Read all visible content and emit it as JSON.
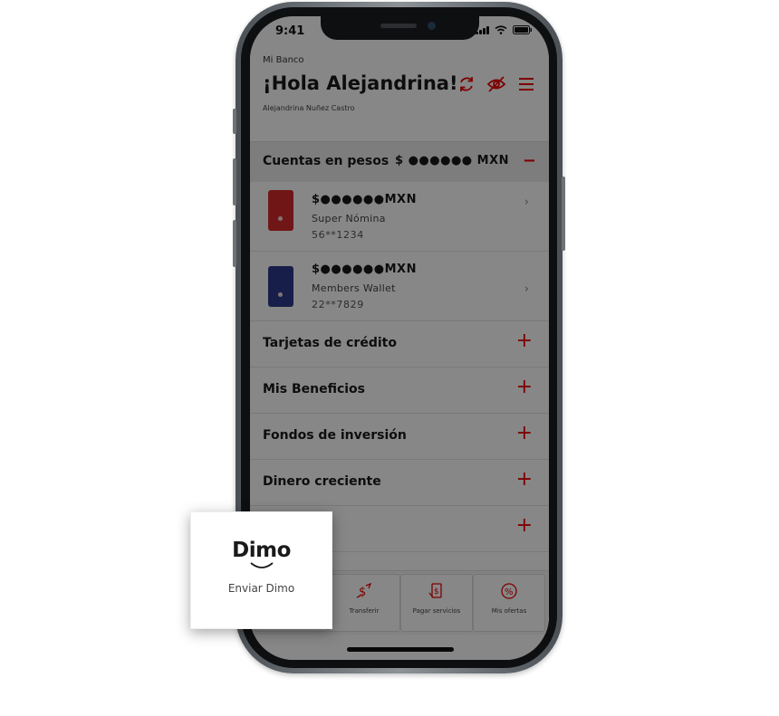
{
  "status_bar": {
    "time": "9:41"
  },
  "header": {
    "bank_label": "Mi Banco",
    "greeting": "¡Hola Alejandrina!",
    "user_name": "Alejandrina Nuñez Castro",
    "icons": [
      "refresh-icon",
      "hide-balance-icon",
      "menu-icon"
    ]
  },
  "accounts_section": {
    "title": "Cuentas en pesos",
    "amount": "$ ●●●●●● MXN",
    "toggle": "−",
    "items": [
      {
        "amount": "$●●●●●●MXN",
        "name": "Super Nómina",
        "number": "56**1234",
        "card_color": "#d62b2b"
      },
      {
        "amount": "$●●●●●●MXN",
        "name": "Members Wallet",
        "number": " 22**7829",
        "card_color": "#2c3a8c"
      }
    ]
  },
  "sections": [
    {
      "label": "Tarjetas de crédito",
      "toggle": "+"
    },
    {
      "label": "Mis Beneficios",
      "toggle": "+"
    },
    {
      "label": "Fondos de inversión",
      "toggle": "+"
    },
    {
      "label": "Dinero creciente",
      "toggle": "+"
    },
    {
      "label": "",
      "toggle": "+"
    }
  ],
  "bottom_nav": [
    {
      "label": "Transferir",
      "icon": "transfer-icon"
    },
    {
      "label": "Pagar servicios",
      "icon": "pay-services-icon"
    },
    {
      "label": "Mis ofertas",
      "icon": "offers-icon"
    }
  ],
  "dimo_popup": {
    "logo": "Dimo",
    "label": "Enviar Dimo"
  },
  "colors": {
    "accent": "#ec0000",
    "overlay": "rgba(0,0,0,0.47)"
  }
}
